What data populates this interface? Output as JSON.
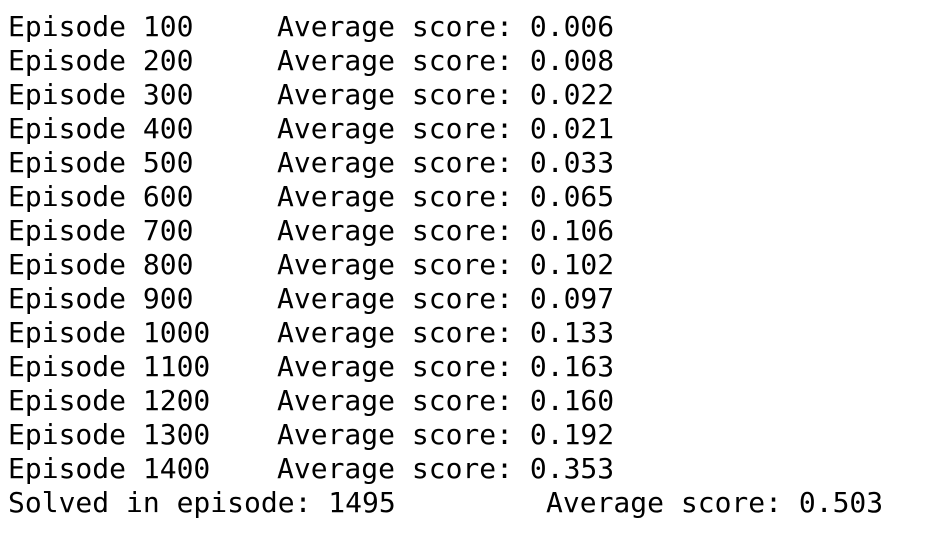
{
  "log": {
    "rows": [
      {
        "episode": "Episode 100",
        "average": "Average score: 0.006"
      },
      {
        "episode": "Episode 200",
        "average": "Average score: 0.008"
      },
      {
        "episode": "Episode 300",
        "average": "Average score: 0.022"
      },
      {
        "episode": "Episode 400",
        "average": "Average score: 0.021"
      },
      {
        "episode": "Episode 500",
        "average": "Average score: 0.033"
      },
      {
        "episode": "Episode 600",
        "average": "Average score: 0.065"
      },
      {
        "episode": "Episode 700",
        "average": "Average score: 0.106"
      },
      {
        "episode": "Episode 800",
        "average": "Average score: 0.102"
      },
      {
        "episode": "Episode 900",
        "average": "Average score: 0.097"
      },
      {
        "episode": "Episode 1000",
        "average": "Average score: 0.133"
      },
      {
        "episode": "Episode 1100",
        "average": "Average score: 0.163"
      },
      {
        "episode": "Episode 1200",
        "average": "Average score: 0.160"
      },
      {
        "episode": "Episode 1300",
        "average": "Average score: 0.192"
      },
      {
        "episode": "Episode 1400",
        "average": "Average score: 0.353"
      }
    ],
    "solved": {
      "left": "Solved in episode: 1495",
      "right": "Average score: 0.503"
    }
  }
}
